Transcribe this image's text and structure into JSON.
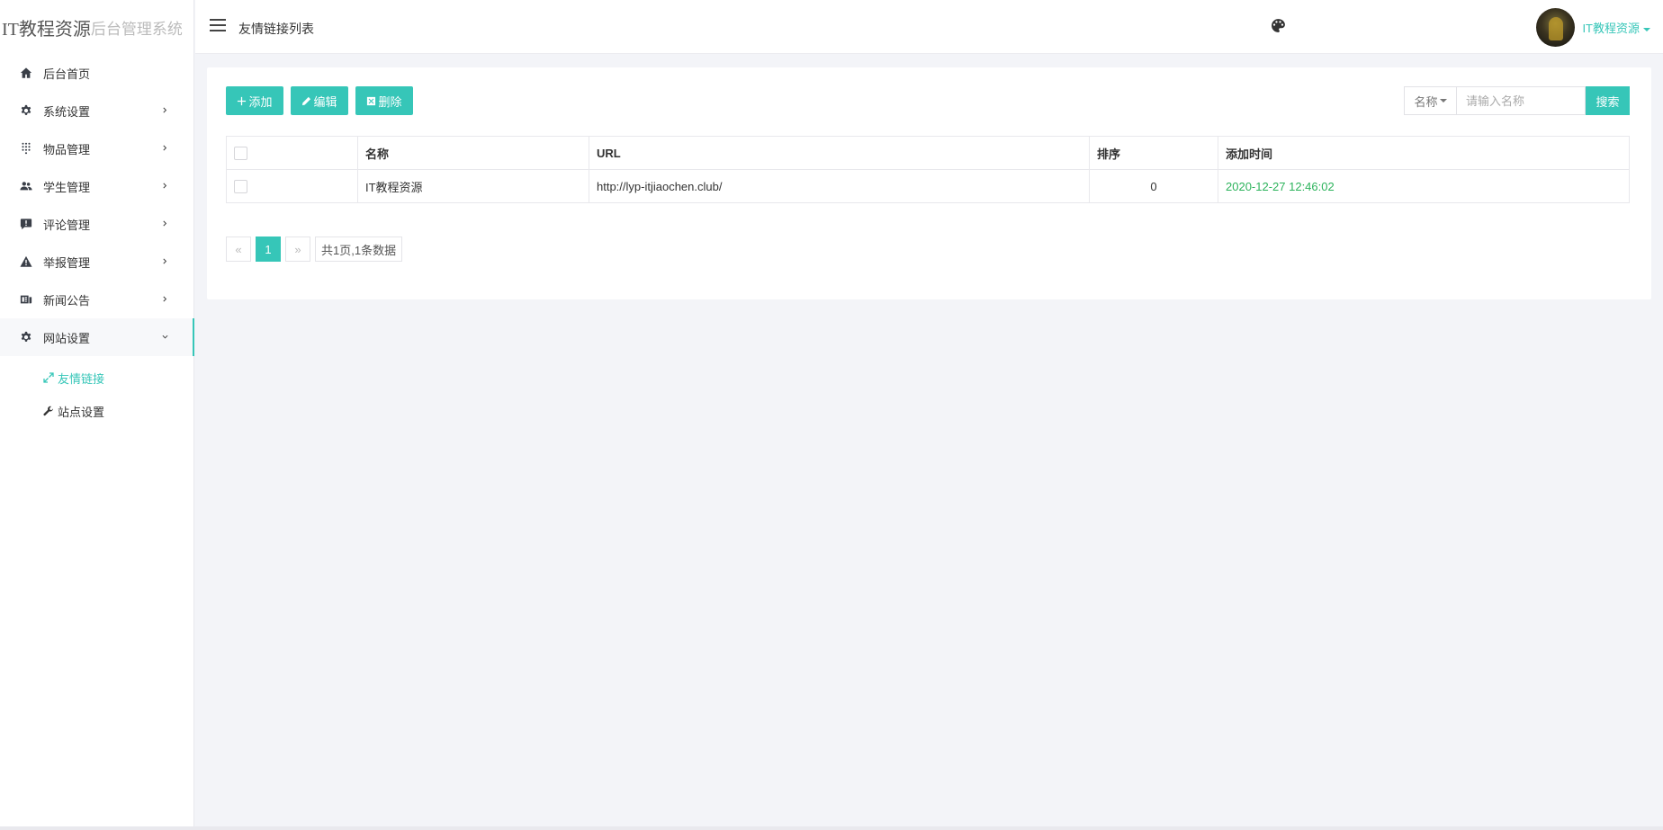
{
  "brand": {
    "main": "IT教程资源",
    "sub": "后台管理系统"
  },
  "header": {
    "page_title": "友情链接列表",
    "user_name": "IT教程资源"
  },
  "sidebar": {
    "items": [
      {
        "label": "后台首页",
        "icon": "home-icon"
      },
      {
        "label": "系统设置",
        "icon": "gear-icon"
      },
      {
        "label": "物品管理",
        "icon": "dots-grid-icon"
      },
      {
        "label": "学生管理",
        "icon": "people-icon"
      },
      {
        "label": "评论管理",
        "icon": "comment-alert-icon"
      },
      {
        "label": "举报管理",
        "icon": "warning-icon"
      },
      {
        "label": "新闻公告",
        "icon": "news-icon"
      },
      {
        "label": "网站设置",
        "icon": "gear-icon",
        "expanded": true
      }
    ],
    "subitems": [
      {
        "label": "友情链接",
        "icon": "expand-arrows-icon",
        "active": true
      },
      {
        "label": "站点设置",
        "icon": "wrench-icon"
      }
    ]
  },
  "toolbar": {
    "add_label": "添加",
    "edit_label": "编辑",
    "delete_label": "删除"
  },
  "search": {
    "field_label": "名称",
    "placeholder": "请输入名称",
    "button_label": "搜索"
  },
  "table": {
    "columns": [
      "名称",
      "URL",
      "排序",
      "添加时间"
    ],
    "rows": [
      {
        "name": "IT教程资源",
        "url": "http://lyp-itjiaochen.club/",
        "sort": "0",
        "time": "2020-12-27 12:46:02"
      }
    ]
  },
  "pagination": {
    "prev": "«",
    "current": "1",
    "next": "»",
    "info": "共1页,1条数据"
  },
  "colors": {
    "accent": "#36c6b8",
    "time_text": "#2db35c"
  }
}
